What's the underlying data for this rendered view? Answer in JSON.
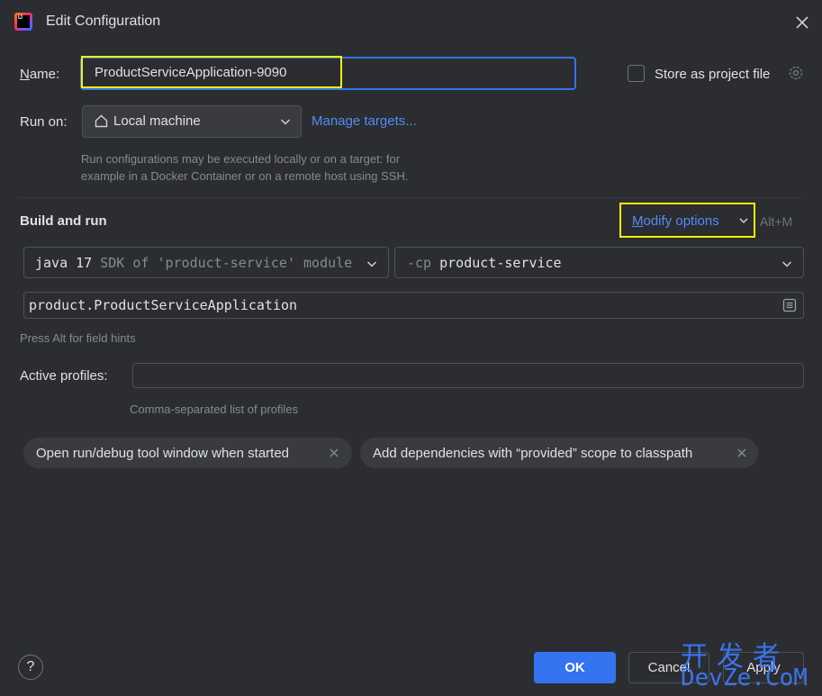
{
  "window": {
    "title": "Edit Configuration",
    "logo_text": "IJ"
  },
  "name": {
    "label": "Name:",
    "value": "ProductServiceApplication-9090"
  },
  "store": {
    "label": "Store as project file",
    "checked": false
  },
  "run_on": {
    "label": "Run on:",
    "selected": "Local machine",
    "manage_targets": "Manage targets...",
    "hint_line1": "Run configurations may be executed locally or on a target: for",
    "hint_line2": "example in a Docker Container or on a remote host using SSH."
  },
  "build_and_run": {
    "title": "Build and run",
    "modify_options_mnemonic": "M",
    "modify_options_rest": "odify options",
    "modify_shortcut": "Alt+M",
    "sdk_main": "java 17",
    "sdk_dim": "SDK of 'product-service' module",
    "cp_flag": "-cp",
    "cp_value": "product-service",
    "main_class": "product.ProductServiceApplication",
    "field_hint": "Press Alt for field hints"
  },
  "profiles": {
    "label": "Active profiles:",
    "value": "",
    "hint": "Comma-separated list of profiles"
  },
  "chips": [
    {
      "label": "Open run/debug tool window when started"
    },
    {
      "label": "Add dependencies with “provided” scope to classpath"
    }
  ],
  "footer": {
    "help": "?",
    "ok": "OK",
    "cancel": "Cancel",
    "apply": "Apply"
  },
  "watermark": {
    "top": "开发者",
    "bottom": "DevZe.CoM"
  },
  "colors": {
    "background": "#2b2d30",
    "accent": "#3574f0",
    "link": "#548af7",
    "highlight": "#f4f000"
  }
}
